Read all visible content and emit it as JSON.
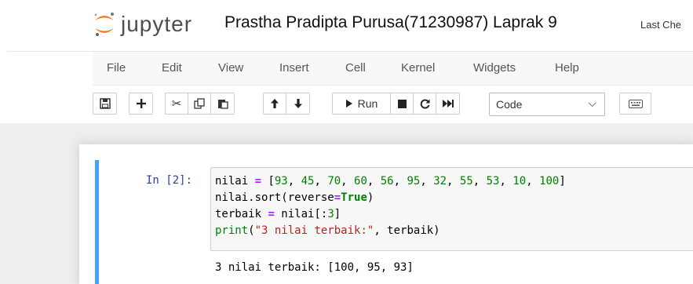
{
  "header": {
    "logo_text": "jupyter",
    "notebook_title": "Prastha Pradipta Purusa(71230987) Laprak 9",
    "last_checkpoint": "Last Che"
  },
  "menubar": {
    "items": [
      "File",
      "Edit",
      "View",
      "Insert",
      "Cell",
      "Kernel",
      "Widgets",
      "Help"
    ]
  },
  "toolbar": {
    "run_label": "Run",
    "cell_type": "Code",
    "icons": [
      "save-icon",
      "plus-icon",
      "scissors-icon",
      "copy-icon",
      "paste-icon",
      "arrow-up-icon",
      "arrow-down-icon",
      "run-icon",
      "stop-icon",
      "restart-icon",
      "fast-forward-icon",
      "keyboard-icon"
    ]
  },
  "cell": {
    "prompt": "In [2]:",
    "code_lines": [
      "nilai = [93, 45, 70, 60, 56, 95, 32, 55, 53, 10, 100]",
      "nilai.sort(reverse=True)",
      "terbaik = nilai[:3]",
      "print(\"3 nilai terbaik:\", terbaik)"
    ],
    "output": "3 nilai terbaik: [100, 95, 93]"
  },
  "colors": {
    "cell_accent": "#42a5f5",
    "prompt": "#303f9f",
    "operator": "#aa22ff",
    "number": "#008000",
    "string": "#ba2121"
  }
}
